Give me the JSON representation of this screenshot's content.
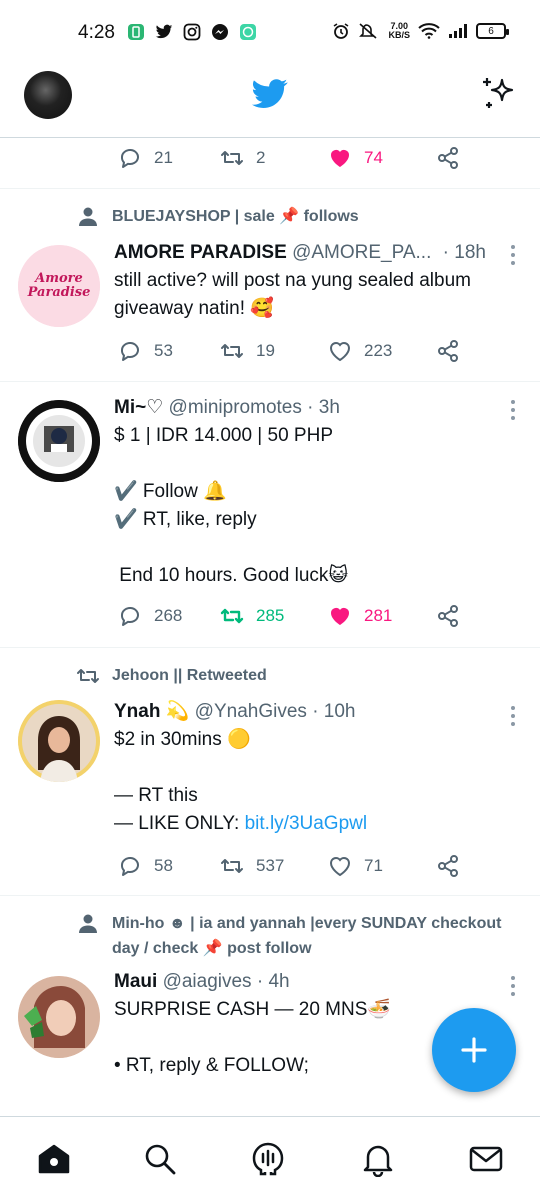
{
  "status_bar": {
    "time": "4:28",
    "apps": [
      "app-icon",
      "twitter-icon",
      "instagram-icon",
      "messenger-icon",
      "chat-icon"
    ],
    "net_speed": "7.00",
    "net_unit": "KB/S",
    "battery": "6"
  },
  "colors": {
    "brand": "#1d9bf0",
    "like": "#f91880",
    "retweet": "#00ba7c",
    "secondary": "#536471"
  },
  "feed": {
    "top_actions": {
      "replies": "21",
      "retweets": "2",
      "likes": "74",
      "liked": true
    },
    "tweets": [
      {
        "context": "BLUEJAYSHOP | sale 📌 follows",
        "context_icon": "person-icon",
        "name": "AMORE PARADISE",
        "handle": "@AMORE_PA...",
        "time": "· 18h",
        "text": "still active? will post na yung sealed album giveaway natin! 🥰",
        "avatar_text": "Amore Paradise",
        "replies": "53",
        "retweets": "19",
        "likes": "223"
      },
      {
        "name": "Mi~♡",
        "handle": "@minipromotes",
        "time": "· 3h",
        "text": "$ 1 | IDR 14.000 | 50 PHP\n\n✔️ Follow 🔔\n✔️ RT, like, reply\n\n End 10 hours. Good luck😺",
        "replies": "268",
        "retweets": "285",
        "likes": "281",
        "retweeted": true,
        "liked": true
      },
      {
        "context": "Jehoon || Retweeted",
        "context_icon": "retweet-icon",
        "name": "Ynah 💫",
        "handle": "@YnahGives",
        "time": "· 10h",
        "text_lines": [
          "$2 in 30mins 🟡",
          "",
          "— RT this"
        ],
        "text_like": "— LIKE ONLY: ",
        "link": "bit.ly/3UaGpwl",
        "replies": "58",
        "retweets": "537",
        "likes": "71"
      },
      {
        "context": "Min-ho ☻ | ia and yannah |every SUNDAY checkout day / check 📌 post follow",
        "context_icon": "person-icon",
        "name": "Maui",
        "handle": "@aiagives",
        "time": "· 4h",
        "text": "SURPRISE CASH — 20 MNS🍜\n\n• RT, reply & FOLLOW;"
      }
    ]
  },
  "fab": {
    "icon": "compose-plus-icon"
  },
  "bottom_nav": [
    "home-icon",
    "search-icon",
    "spaces-icon",
    "notifications-icon",
    "messages-icon"
  ]
}
